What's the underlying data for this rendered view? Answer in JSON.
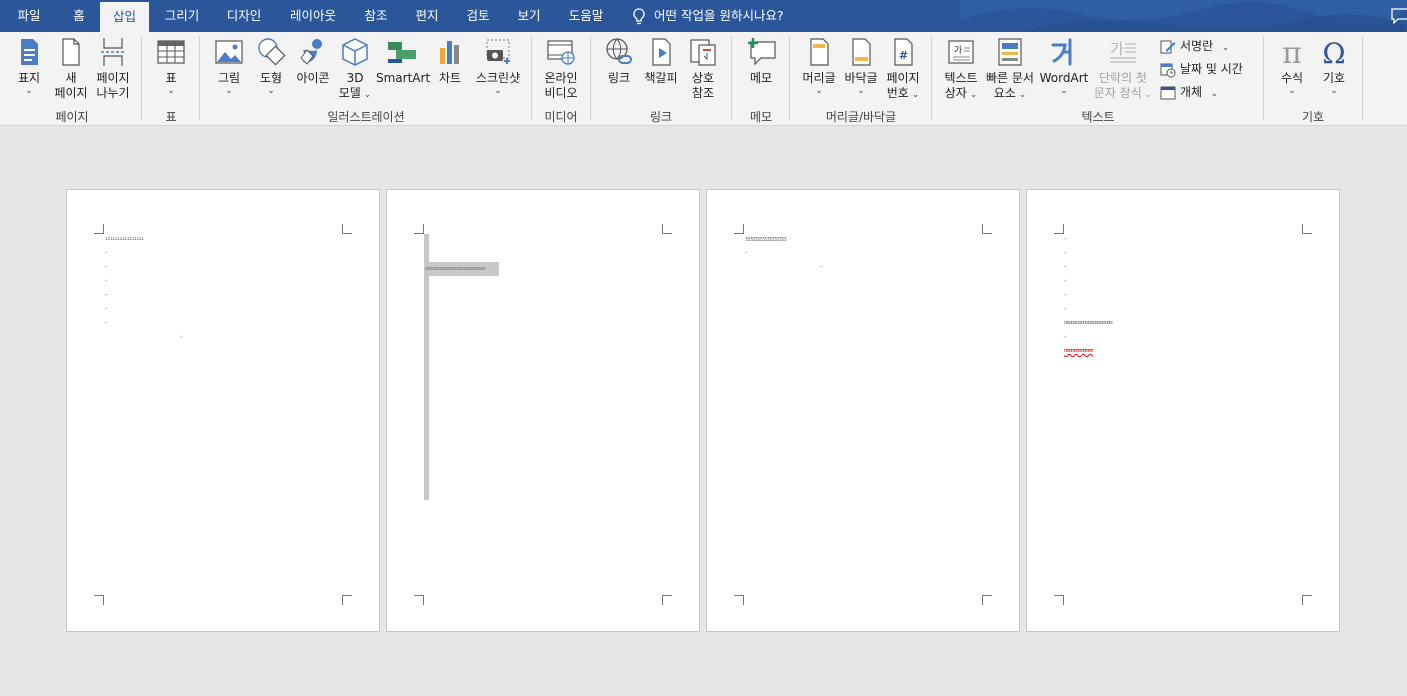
{
  "tabs": [
    {
      "label": "파일"
    },
    {
      "label": "홈"
    },
    {
      "label": "삽입"
    },
    {
      "label": "그리기"
    },
    {
      "label": "디자인"
    },
    {
      "label": "레이아웃"
    },
    {
      "label": "참조"
    },
    {
      "label": "편지"
    },
    {
      "label": "검토"
    },
    {
      "label": "보기"
    },
    {
      "label": "도움말"
    }
  ],
  "active_tab": "삽입",
  "tell_me": "어떤 작업을 원하시나요?",
  "groups": {
    "pages": {
      "label": "페이지",
      "cover": "표지",
      "new_page_1": "새",
      "new_page_2": "페이지",
      "break_1": "페이지",
      "break_2": "나누기"
    },
    "tables": {
      "label": "표",
      "table": "표"
    },
    "illustrations": {
      "label": "일러스트레이션",
      "picture": "그림",
      "shapes": "도형",
      "icons": "아이콘",
      "model_1": "3D",
      "model_2": "모델",
      "smartart": "SmartArt",
      "chart": "차트",
      "screenshot": "스크린샷"
    },
    "media": {
      "label": "미디어",
      "video_1": "온라인",
      "video_2": "비디오"
    },
    "links": {
      "label": "링크",
      "link": "링크",
      "bookmark": "책갈피",
      "xref_1": "상호",
      "xref_2": "참조"
    },
    "comments": {
      "label": "메모",
      "comment": "메모"
    },
    "header_footer": {
      "label": "머리글/바닥글",
      "header": "머리글",
      "footer": "바닥글",
      "page_num_1": "페이지",
      "page_num_2": "번호"
    },
    "text": {
      "label": "텍스트",
      "textbox_1": "텍스트",
      "textbox_2": "상자",
      "quickparts_1": "빠른 문서",
      "quickparts_2": "요소",
      "wordart": "WordArt",
      "dropcap_1": "단락의 첫",
      "dropcap_2": "문자 장식",
      "signature": "서명란",
      "datetime": "날짜 및 시간",
      "object": "개체"
    },
    "symbols": {
      "label": "기호",
      "equation": "수식",
      "symbol": "기호"
    }
  },
  "icons": {
    "shapes_glyph": "가",
    "equation_glyph": "π",
    "symbol_glyph": "Ω",
    "page_num_glyph": "#"
  },
  "colors": {
    "accent": "#2b579a",
    "ribbon_bg": "#f3f3f3",
    "doc_bg": "#e6e6e6"
  },
  "pages": [
    {
      "line1": "ıııııııııııııııı"
    },
    {
      "line1": "ƨƨƨƨƨƨƨƨƨƨƨƨƨƨƨƨƨƨƨƨƨƨƨƨƨ"
    },
    {
      "line1": "ʒʒʒʒʒʒʒʒʒʒʒʒʒʒʒʒʒ"
    },
    {
      "line1": "ɑɑɑɑɑɑɑɑɑɑɑɑɑɑɑɑɑɑɑɑ",
      "line2": "ʊʊʊʊʊʊʊʊʊʊʊʊ"
    }
  ]
}
